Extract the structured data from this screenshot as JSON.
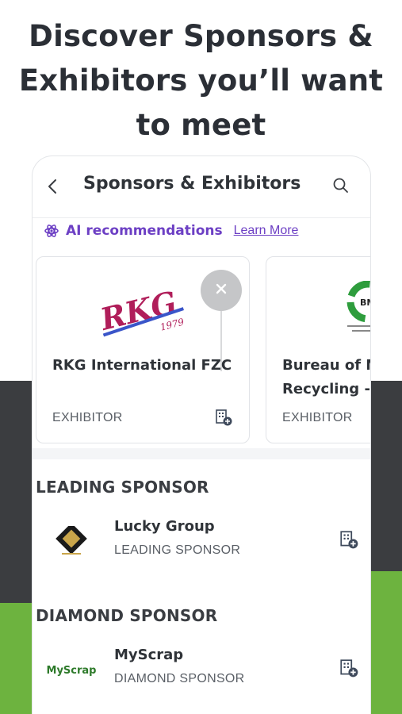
{
  "headline": {
    "line1": "Discover Sponsors &",
    "line2": "Exhibitors you’ll want",
    "line3": "to meet"
  },
  "header": {
    "title": "Sponsors & Exhibitors",
    "back_icon": "chevron-left-icon",
    "search_icon": "search-icon"
  },
  "ai": {
    "label": "AI recommendations",
    "learn_more": "Learn More",
    "icon": "atom-icon"
  },
  "cards": [
    {
      "name": "RKG International FZC",
      "type": "EXHIBITOR",
      "logo_text": "RKG",
      "logo_year": "1979"
    },
    {
      "name_line1": "Bureau of M",
      "name_line2": "Recycling -",
      "type": "EXHIBITOR",
      "logo_text": "BMR"
    }
  ],
  "sections": [
    {
      "heading": "LEADING SPONSOR",
      "items": [
        {
          "name": "Lucky Group",
          "type": "LEADING SPONSOR"
        }
      ]
    },
    {
      "heading": "DIAMOND SPONSOR",
      "items": [
        {
          "name": "MyScrap",
          "type": "DIAMOND SPONSOR",
          "logo_text": "MyScrap"
        }
      ]
    }
  ],
  "colors": {
    "accent": "#6c3fc4",
    "dark_band": "#3b3d40",
    "green_band": "#6db33f",
    "rkg_red": "#b01e5a",
    "rkg_blue": "#3a55c9"
  }
}
